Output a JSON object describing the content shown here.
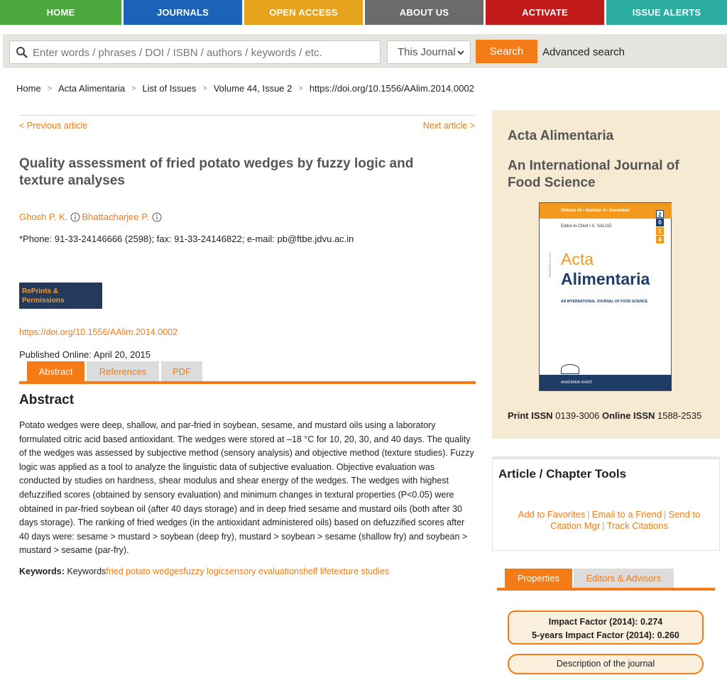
{
  "nav": [
    {
      "label": "HOME",
      "color": "#4aa83c"
    },
    {
      "label": "JOURNALS",
      "color": "#1b63b8"
    },
    {
      "label": "OPEN ACCESS",
      "color": "#e5a31e"
    },
    {
      "label": "ABOUT US",
      "color": "#6b6b6b"
    },
    {
      "label": "ACTIVATE",
      "color": "#c01a1a"
    },
    {
      "label": "ISSUE ALERTS",
      "color": "#2bada2"
    }
  ],
  "search": {
    "placeholder": "Enter words / phrases / DOI / ISBN / authors / keywords / etc.",
    "scope": "This Journal",
    "button": "Search",
    "advanced": "Advanced search"
  },
  "breadcrumb": [
    "Home",
    "Acta Alimentaria",
    "List of Issues",
    "Volume 44, Issue 2",
    "https://doi.org/10.1556/AAlim.2014.0002"
  ],
  "article": {
    "prev": "< Previous article",
    "next": "Next article >",
    "title": "Quality assessment of fried potato wedges by fuzzy logic and texture analyses",
    "author1": "Ghosh P. K.",
    "author2": "Bhattacharjee P.",
    "contact": "*Phone: 91-33-24146666 (2598); fax: 91-33-24146822; e-mail: pb@ftbe.jdvu.ac.in",
    "reprints": "RePrints & Permissions",
    "doi": "https://doi.org/10.1556/AAlim.2014.0002",
    "published": "Published Online: April 20, 2015",
    "tabs": [
      "Abstract",
      "References",
      "PDF"
    ],
    "abstract_heading": "Abstract",
    "abstract": "Potato wedges were deep, shallow, and par-fried in soybean, sesame, and mustard oils using a laboratory formulated citric acid based antioxidant. The wedges were stored at –18 °C for 10, 20, 30, and 40 days. The quality of the wedges was assessed by subjective method (sensory analysis) and objective method (texture studies). Fuzzy logic was applied as a tool to analyze the linguistic data of subjective evaluation. Objective evaluation was conducted by studies on hardness, shear modulus and shear energy of the wedges. The wedges with highest defuzzified scores (obtained by sensory evaluation) and minimum changes in textural properties (P<0.05) were obtained in par-fried soybean oil (after 40 days storage) and in deep fried sesame and mustard oils (both after 30 days storage). The ranking of fried wedges (in the antioxidant administered oils) based on defuzzified scores after 40 days were: sesame > mustard > soybean (deep fry), mustard > soybean > sesame (shallow fry) and soybean > mustard > sesame (par-fry).",
    "keywords_label": "Keywords:",
    "keywords_prefix": "Keywords",
    "keywords": [
      "fried potato wedges",
      "fuzzy logic",
      "sensory evaluation",
      "shelf life",
      "texture studies"
    ]
  },
  "journal": {
    "title": "Acta Alimentaria",
    "subtitle": "An International Journal of Food Science",
    "cover": {
      "band": "Volume 43 • Number 4 • December",
      "editor": "Editor-in-Chief • A. SALGÓ",
      "year": [
        "2",
        "0",
        "1",
        "4"
      ],
      "title1": "Acta",
      "title2": "Alimentaria",
      "sub": "AN INTERNATIONAL JOURNAL OF FOOD SCIENCE",
      "founded": "FOUNDED IN 1972",
      "publisher": "AKADÉMIAI KIADÓ"
    },
    "print_issn_label": "Print ISSN",
    "print_issn": "0139-3006",
    "online_issn_label": "Online ISSN",
    "online_issn": "1588-2535"
  },
  "tools": {
    "heading": "Article / Chapter Tools",
    "add_favorites": "Add to Favorites",
    "email_friend": "Email to a Friend",
    "send_citation": "Send to Citation Mgr",
    "track": "Track Citations"
  },
  "props": {
    "tabs": [
      "Properties",
      "Editors & Advisors"
    ],
    "impact": "Impact Factor (2014): 0.274",
    "impact5": "5-years Impact Factor (2014): 0.260",
    "description": "Description of the journal"
  },
  "colors": {
    "accent": "#f47b16",
    "navy": "#233a5a",
    "journal_bg": "#f7ead3"
  }
}
